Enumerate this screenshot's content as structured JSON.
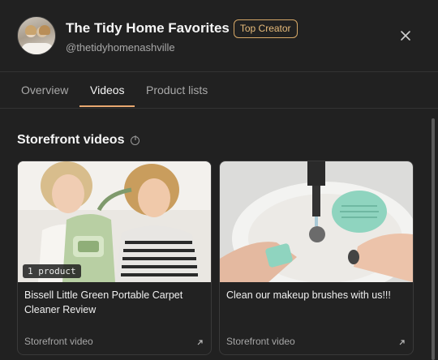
{
  "header": {
    "title": "The Tidy Home Favorites",
    "badge": "Top Creator",
    "handle": "@thetidyhomenashville"
  },
  "tabs": [
    {
      "label": "Overview",
      "active": false
    },
    {
      "label": "Videos",
      "active": true
    },
    {
      "label": "Product lists",
      "active": false
    }
  ],
  "section": {
    "title": "Storefront videos"
  },
  "cards": [
    {
      "title": "Bissell Little Green Portable Carpet Cleaner Review",
      "tag": "1 product",
      "footer": "Storefront video"
    },
    {
      "title": "Clean our makeup brushes with us!!!",
      "footer": "Storefront video"
    }
  ],
  "colors": {
    "background": "#212121",
    "accent": "#e8a870",
    "badge_border": "#d6a867"
  }
}
